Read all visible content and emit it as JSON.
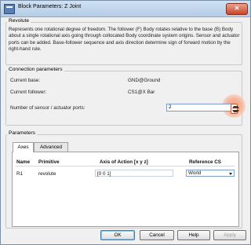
{
  "window": {
    "title": "Block Parameters: Z Joint",
    "close_glyph": "✕"
  },
  "revolute_group": {
    "title": "Revolute",
    "description": "Represents one rotational degree of freedom. The follower (F) Body rotates relative to the base (B) Body about a single rotational axis going through collocated Body coordinate system origins. Sensor and actuator ports can be added. Base-follower sequence and axis direction determine sign of forward motion by the right-hand rule."
  },
  "connection": {
    "title": "Connection parameters",
    "current_base_label": "Current base:",
    "current_base_value": "GND@Ground",
    "current_follower_label": "Current follower:",
    "current_follower_value": "CS1@X Bar",
    "ports_label": "Number of sensor / actuator ports:",
    "ports_value": "2"
  },
  "parameters": {
    "title": "Parameters",
    "tabs": [
      {
        "label": "Axes",
        "active": true
      },
      {
        "label": "Advanced",
        "active": false
      }
    ],
    "columns": [
      "Name",
      "Primitive",
      "Axis of Action [x y z]",
      "Reference CS"
    ],
    "rows": [
      {
        "name": "R1",
        "primitive": "revolute",
        "axis": "[0 0 1]",
        "reference": "World"
      }
    ]
  },
  "buttons": {
    "ok": "OK",
    "cancel": "Cancel",
    "help": "Help",
    "apply": "Apply"
  },
  "colors": {
    "title_bar": "#b6cde6",
    "close_button": "#c8452a",
    "highlight": "#f2a07a"
  },
  "icons": {
    "app": "block-parameters-icon",
    "spinner": "spinner-arrows-icon",
    "dropdown": "chevron-down-icon"
  }
}
